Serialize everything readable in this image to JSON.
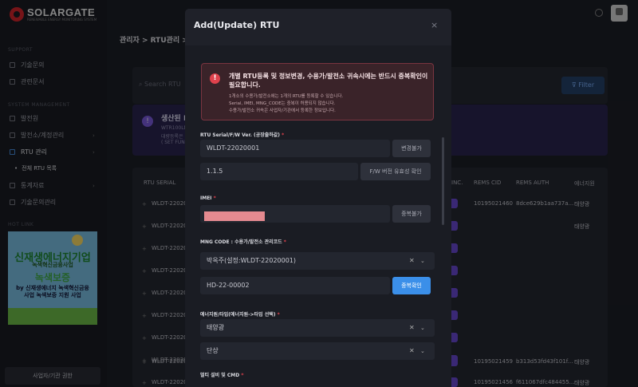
{
  "app": {
    "logo": "SOLARGATE",
    "logo_tagline": "RENEWABLE ENERGY MONITORING SYSTEM"
  },
  "sidebar": {
    "section_support": "SUPPORT",
    "section_system": "SYSTEM MANAGEMENT",
    "section_hot": "HOT LINK",
    "items": [
      {
        "label": "기술문의"
      },
      {
        "label": "관련문서"
      },
      {
        "label": "발전원"
      },
      {
        "label": "발전소/계정관리"
      },
      {
        "label": "RTU 관리"
      },
      {
        "label": "통계자료"
      },
      {
        "label": "기술문의관리"
      }
    ],
    "sub_active": "전체 RTU 목록",
    "banner": {
      "line1": "신재생에너지기업",
      "line2": "녹색혁신금융사업",
      "line3": "녹색보증",
      "line4": "by 신재생에너지 녹색혁신금융",
      "line5": "사업 녹색보증 지원 사업"
    },
    "footer_button": "사업자/기관 권한"
  },
  "header": {
    "breadcrumb": "관리자 > RTU관리 >"
  },
  "background": {
    "search_placeholder": "Search RTU",
    "filter_label": "Filter",
    "notice": {
      "title": "생산된 F",
      "lines": [
        "WTR100LM",
        "대량등록은",
        "( SET FUN"
      ]
    },
    "columns": {
      "serial": "RTU SERIAL",
      "inc": "INC.",
      "rems_cid": "REMS CID",
      "rems_auth": "REMS AUTH",
      "energy": "에너지원"
    },
    "rows": [
      {
        "serial": "WLDT-22020",
        "cid": "10195021460",
        "auth": "8dce629b1aa737a...",
        "energy": "태양광"
      },
      {
        "serial": "WLDT-22020",
        "cid": "",
        "auth": "",
        "energy": "태양광"
      },
      {
        "serial": "WLDT-22020",
        "cid": "",
        "auth": "",
        "energy": ""
      },
      {
        "serial": "WLDT-22020",
        "cid": "",
        "auth": "",
        "energy": ""
      },
      {
        "serial": "WLDT-22020",
        "cid": "",
        "auth": "",
        "energy": ""
      },
      {
        "serial": "WLDT-22020",
        "cid": "",
        "auth": "",
        "energy": ""
      },
      {
        "serial": "WLDT-22020",
        "cid": "",
        "auth": "",
        "energy": ""
      },
      {
        "serial": "WLDT-22020",
        "cid": "",
        "auth": "",
        "energy": ""
      },
      {
        "serial": "WLDT-22020",
        "cid": "10195021459",
        "auth": "b313d53fd43f101f...",
        "energy": "태양광"
      },
      {
        "serial": "WLDT-22020",
        "cid": "10195021456",
        "auth": "f611067dfc484455...",
        "energy": "태양광"
      }
    ]
  },
  "modal": {
    "title": "Add(Update) RTU",
    "close": "×",
    "alert": {
      "title": "개별 RTU등록 및 정보변경, 수용가/발전소 귀속시에는 반드시 중복확인이 필요합니다.",
      "lines": [
        "1개소의 수용가/발전소에는 1개의 RTU를 등록할 수 있습니다.",
        "Serial, IMEI, MNG_CODE는 중복이 허용되지 않습니다.",
        "수용가/발전소 귀속은 사업자/기관에서 등록한 정보입니다."
      ]
    },
    "rtu_label": "RTU Serial/F/W Ver. (공장출하값)",
    "rtu_serial": "WLDT-22020001",
    "rtu_serial_btn": "변경불가",
    "fw_ver": "1.1.5",
    "fw_btn": "F/W 버전 유효성 확인",
    "imei_label": "IMEI",
    "imei_btn": "중복불가",
    "mng_label": "MNG CODE : 수용가/발전소 관리코드",
    "mng_select": "박옥주(설정:WLDT-22020001)",
    "mng_code": "HD-22-00002",
    "mng_btn": "중복확인",
    "energy_label": "에너지원/타입(에너지원->타입 선택)",
    "energy_select": "태양광",
    "type_select": "단상",
    "multi_label": "멀티 설비 및 CMD",
    "req": "*"
  }
}
